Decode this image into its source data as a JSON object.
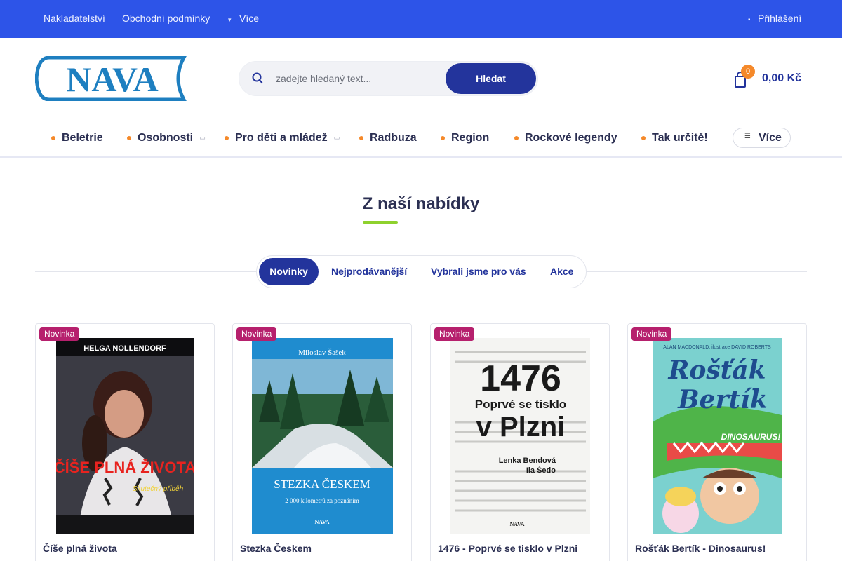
{
  "topbar": {
    "links": [
      "Nakladatelství",
      "Obchodní podmínky"
    ],
    "more_label": "Více",
    "more_icon": "chevron-down-icon",
    "login_label": "Přihlášení",
    "login_icon": "user-icon",
    "color": "#2d54e8"
  },
  "header": {
    "logo_text": "NAVA",
    "search": {
      "placeholder": "zadejte hledaný text...",
      "value": "",
      "button_label": "Hledat",
      "icon": "search-icon"
    },
    "cart": {
      "count": "0",
      "amount": "0,00 Kč",
      "icon": "shopping-bag-icon"
    }
  },
  "nav": {
    "items": [
      {
        "label": "Beletrie"
      },
      {
        "label": "Osobnosti"
      },
      {
        "label": "Pro děti a mládež"
      },
      {
        "label": "Radbuza"
      },
      {
        "label": "Region"
      },
      {
        "label": "Rockové legendy"
      },
      {
        "label": "Tak určitě!"
      }
    ],
    "more_label": "Více",
    "more_icon": "menu-icon"
  },
  "section": {
    "title": "Z naší nabídky",
    "tabs": [
      {
        "label": "Novinky",
        "active": true
      },
      {
        "label": "Nejprodávanější",
        "active": false
      },
      {
        "label": "Vybrali jsme pro vás",
        "active": false
      },
      {
        "label": "Akce",
        "active": false
      }
    ]
  },
  "products": [
    {
      "badge": "Novinka",
      "name": "Číše plná života",
      "cover": {
        "author": "HELGA NOLLENDORF",
        "title": "ČÍŠE PLNÁ ŽIVOTA",
        "subtitle": "Skutečný příběh"
      }
    },
    {
      "badge": "Novinka",
      "name": "Stezka Českem",
      "cover": {
        "author": "Miloslav Šašek",
        "title": "STEZKA ČESKEM",
        "subtitle": "2 000 kilometrů za poznáním",
        "publisher": "NAVA"
      }
    },
    {
      "badge": "Novinka",
      "name": "1476 - Poprvé se tisklo v Plzni",
      "cover": {
        "title_big": "1476",
        "title_mid": "Poprvé se tisklo",
        "title_end": "v Plzni",
        "author": "Lenka Bendová",
        "author2": "Ila Šedo",
        "publisher": "NAVA"
      }
    },
    {
      "badge": "Novinka",
      "name": "Rošťák Bertík - Dinosaurus!",
      "cover": {
        "author": "ALAN MACDONALD, ilustrace DAVID ROBERTS",
        "title_a": "Rošťák",
        "title_b": "Bertík",
        "subtitle": "DINOSAURUS!"
      }
    }
  ],
  "colors": {
    "brand_dark": "#23349c",
    "accent_orange": "#f5892a",
    "badge_magenta": "#b6206d",
    "underline_green": "#8ed12d"
  }
}
